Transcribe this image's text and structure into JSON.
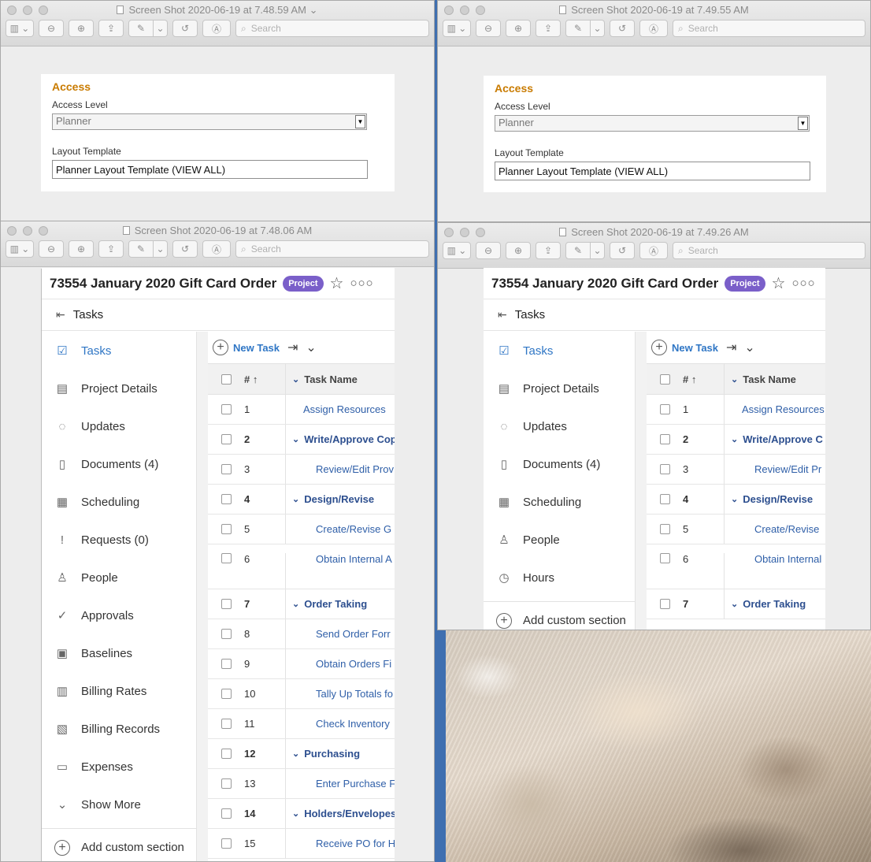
{
  "windows": {
    "tl": {
      "title": "Screen Shot 2020-06-19 at 7.48.59 AM"
    },
    "tr": {
      "title": "Screen Shot 2020-06-19 at 7.49.55 AM"
    },
    "bl": {
      "title": "Screen Shot 2020-06-19 at 7.48.06 AM"
    },
    "br": {
      "title": "Screen Shot 2020-06-19 at 7.49.26 AM"
    }
  },
  "toolbar": {
    "search_placeholder": "Search"
  },
  "access": {
    "heading": "Access",
    "level_label": "Access Level",
    "level_value": "Planner",
    "template_label": "Layout Template",
    "template_value": "Planner Layout Template (VIEW ALL)"
  },
  "project": {
    "title": "73554 January 2020 Gift Card Order",
    "badge": "Project",
    "tasks_header": "Tasks",
    "new_task": "New Task",
    "columns": {
      "num": "#",
      "name": "Task Name"
    }
  },
  "nav_left": [
    {
      "label": "Tasks",
      "icon": "clipboard-check-icon",
      "glyph": "☑",
      "active": true
    },
    {
      "label": "Project Details",
      "icon": "document-icon",
      "glyph": "▤"
    },
    {
      "label": "Updates",
      "icon": "chat-bubble-icon",
      "glyph": "◌"
    },
    {
      "label": "Documents (4)",
      "icon": "file-icon",
      "glyph": "▯"
    },
    {
      "label": "Scheduling",
      "icon": "calendar-icon",
      "glyph": "▦"
    },
    {
      "label": "Requests (0)",
      "icon": "request-icon",
      "glyph": "!"
    },
    {
      "label": "People",
      "icon": "person-icon",
      "glyph": "♙"
    },
    {
      "label": "Approvals",
      "icon": "check-circle-icon",
      "glyph": "✓"
    },
    {
      "label": "Baselines",
      "icon": "baseline-icon",
      "glyph": "▣"
    },
    {
      "label": "Billing Rates",
      "icon": "billing-rates-icon",
      "glyph": "▥"
    },
    {
      "label": "Billing Records",
      "icon": "billing-records-icon",
      "glyph": "▧"
    },
    {
      "label": "Expenses",
      "icon": "money-icon",
      "glyph": "▭"
    },
    {
      "label": "Show More",
      "icon": "chevron-down-icon",
      "glyph": "⌄"
    }
  ],
  "nav_right": [
    {
      "label": "Tasks",
      "icon": "clipboard-check-icon",
      "glyph": "☑",
      "active": true
    },
    {
      "label": "Project Details",
      "icon": "document-icon",
      "glyph": "▤"
    },
    {
      "label": "Updates",
      "icon": "chat-bubble-icon",
      "glyph": "◌"
    },
    {
      "label": "Documents (4)",
      "icon": "file-icon",
      "glyph": "▯"
    },
    {
      "label": "Scheduling",
      "icon": "calendar-icon",
      "glyph": "▦"
    },
    {
      "label": "People",
      "icon": "person-icon",
      "glyph": "♙"
    },
    {
      "label": "Hours",
      "icon": "clock-icon",
      "glyph": "◷"
    }
  ],
  "add_custom_section": "Add custom section",
  "tasks_left": [
    {
      "num": "1",
      "name": "Assign Resources",
      "kind": "top"
    },
    {
      "num": "2",
      "name": "Write/Approve Cop",
      "kind": "parent"
    },
    {
      "num": "3",
      "name": "Review/Edit Prov",
      "kind": "child"
    },
    {
      "num": "4",
      "name": "Design/Revise",
      "kind": "parent"
    },
    {
      "num": "5",
      "name": "Create/Revise G",
      "kind": "child"
    },
    {
      "num": "6",
      "name": "Obtain Internal A",
      "kind": "child",
      "tall": true
    },
    {
      "num": "7",
      "name": "Order Taking",
      "kind": "parent"
    },
    {
      "num": "8",
      "name": "Send Order Forr",
      "kind": "child"
    },
    {
      "num": "9",
      "name": "Obtain Orders Fi",
      "kind": "child"
    },
    {
      "num": "10",
      "name": "Tally Up Totals fo",
      "kind": "child"
    },
    {
      "num": "11",
      "name": "Check Inventory",
      "kind": "child"
    },
    {
      "num": "12",
      "name": "Purchasing",
      "kind": "parent"
    },
    {
      "num": "13",
      "name": "Enter Purchase F",
      "kind": "child"
    },
    {
      "num": "14",
      "name": "Holders/Envelopes",
      "kind": "parent"
    },
    {
      "num": "15",
      "name": "Receive PO for H",
      "kind": "child"
    }
  ],
  "tasks_right": [
    {
      "num": "1",
      "name": "Assign Resources",
      "kind": "top"
    },
    {
      "num": "2",
      "name": "Write/Approve C",
      "kind": "parent"
    },
    {
      "num": "3",
      "name": "Review/Edit Pr",
      "kind": "child"
    },
    {
      "num": "4",
      "name": "Design/Revise",
      "kind": "parent"
    },
    {
      "num": "5",
      "name": "Create/Revise",
      "kind": "child"
    },
    {
      "num": "6",
      "name": "Obtain Internal",
      "kind": "child",
      "tall": true
    },
    {
      "num": "7",
      "name": "Order Taking",
      "kind": "parent"
    }
  ]
}
